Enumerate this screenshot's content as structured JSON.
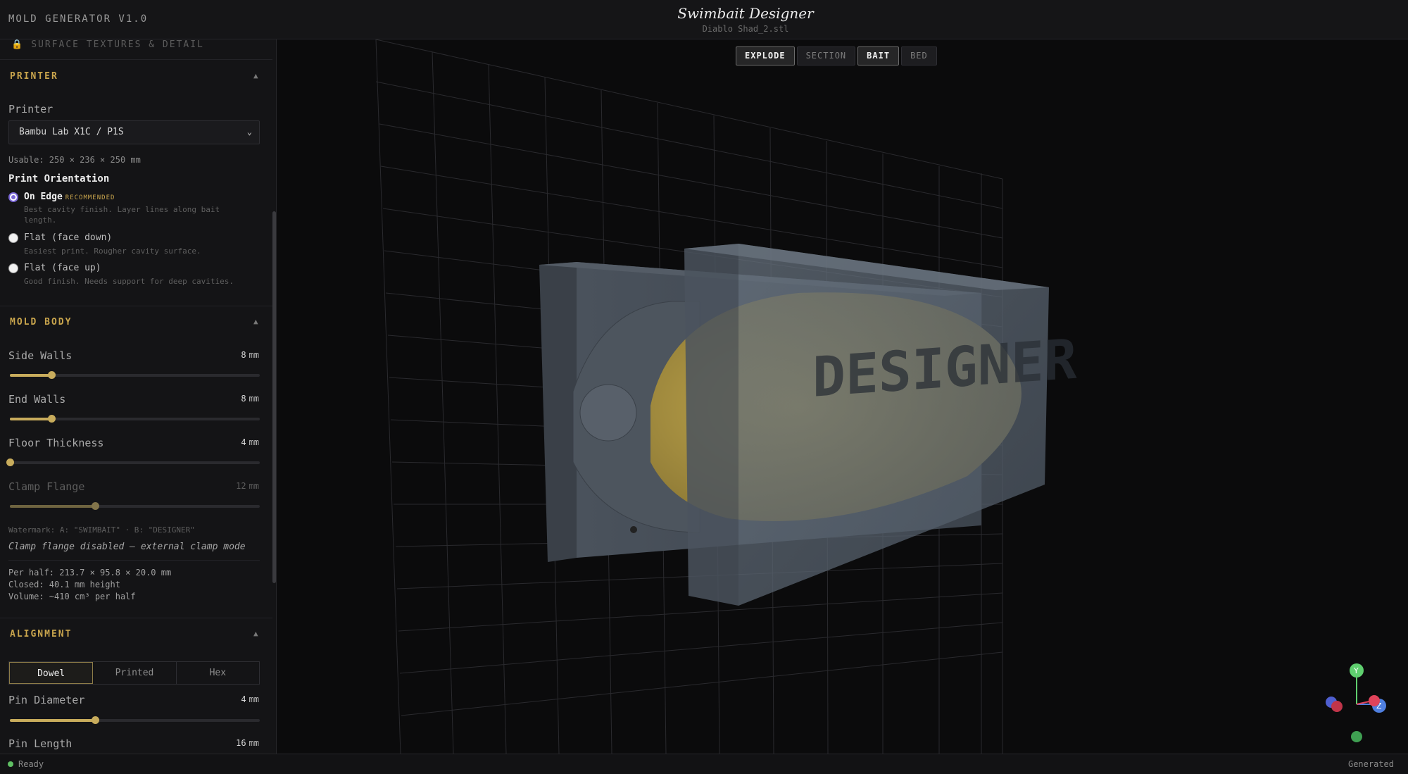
{
  "app": {
    "name": "MOLD GENERATOR V1.0",
    "title": "Swimbait Designer",
    "file": "Diablo Shad_2.stl"
  },
  "sidebar": {
    "locked_section": "SURFACE TEXTURES & DETAIL",
    "printer": {
      "heading": "PRINTER",
      "label": "Printer",
      "selected": "Bambu Lab X1C / P1S",
      "usable": "Usable: 250 × 236 × 250 mm",
      "orientation_heading": "Print Orientation",
      "options": [
        {
          "title": "On Edge",
          "badge": "RECOMMENDED",
          "desc": "Best cavity finish. Layer lines along bait length.",
          "selected": true
        },
        {
          "title": "Flat (face down)",
          "desc": "Easiest print. Rougher cavity surface.",
          "selected": false
        },
        {
          "title": "Flat (face up)",
          "desc": "Good finish. Needs support for deep cavities.",
          "selected": false
        }
      ]
    },
    "mold_body": {
      "heading": "MOLD BODY",
      "sliders": [
        {
          "label": "Side Walls",
          "value": "8",
          "unit": "mm",
          "fraction": 0.165
        },
        {
          "label": "End Walls",
          "value": "8",
          "unit": "mm",
          "fraction": 0.165
        },
        {
          "label": "Floor Thickness",
          "value": "4",
          "unit": "mm",
          "fraction": 0.0
        },
        {
          "label": "Clamp Flange",
          "value": "12",
          "unit": "mm",
          "fraction": 0.34
        }
      ],
      "watermark": "Watermark: A: \"SWIMBAIT\" · B: \"DESIGNER\"",
      "clamp_note": "Clamp flange disabled — external clamp mode",
      "per_half": "Per half: 213.7 × 95.8 × 20.0 mm",
      "closed": "Closed: 40.1 mm height",
      "volume": "Volume: ~410 cm³ per half"
    },
    "alignment": {
      "heading": "ALIGNMENT",
      "modes": [
        "Dowel",
        "Printed",
        "Hex"
      ],
      "active_mode": "Dowel",
      "pin_diameter": {
        "label": "Pin Diameter",
        "value": "4",
        "unit": "mm",
        "fraction": 0.34
      },
      "pin_length": {
        "label": "Pin Length",
        "value": "16",
        "unit": "mm"
      }
    }
  },
  "viewport": {
    "buttons": [
      {
        "label": "EXPLODE",
        "active": true
      },
      {
        "label": "SECTION",
        "active": false
      },
      {
        "label": "BAIT",
        "active": true
      },
      {
        "label": "BED",
        "active": false
      }
    ],
    "model_text": "DESIGNER",
    "axis_labels": {
      "y": "Y",
      "z": "Z"
    },
    "colors": {
      "mold": "#5a6470",
      "bait": "#b8a048",
      "axis_x": "#e0435a",
      "axis_y": "#5fcf6f",
      "axis_z": "#4f7fe0"
    }
  },
  "status": {
    "left": "Ready",
    "right": "Generated"
  }
}
